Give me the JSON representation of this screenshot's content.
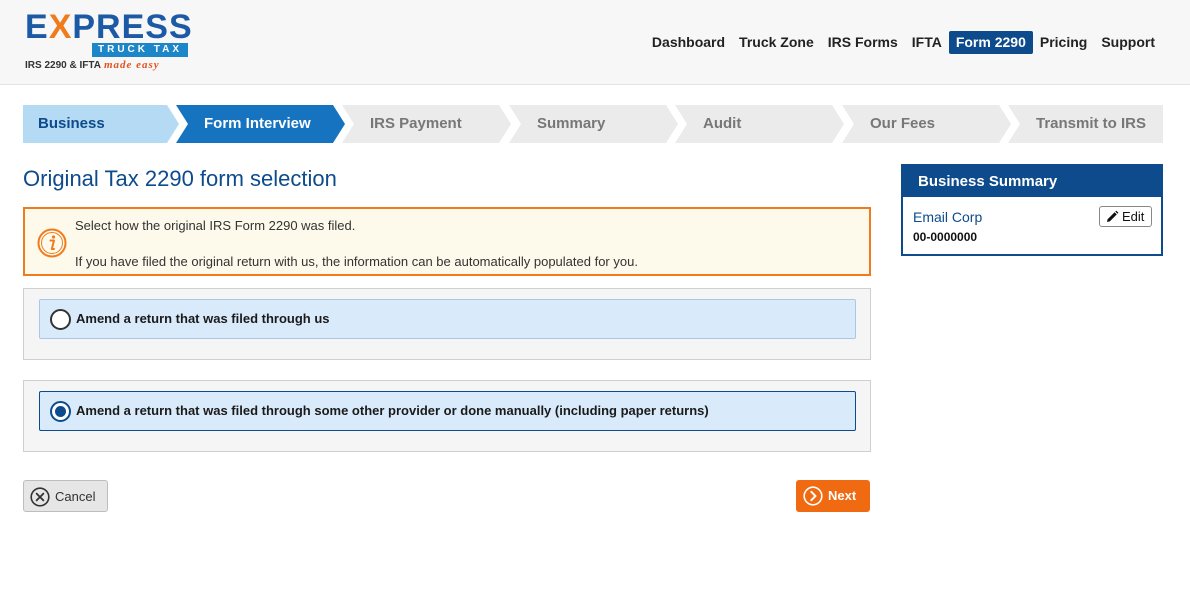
{
  "brand": {
    "word_pre": "E",
    "word_x": "X",
    "word_post": "PRESS",
    "band": "TRUCK TAX",
    "tagline": "IRS 2290 & IFTA",
    "tagline_script": "made easy",
    "colors": {
      "primary": "#1d5aa5",
      "accent": "#f07b1d",
      "band": "#1d86c9"
    }
  },
  "topnav": {
    "items": [
      {
        "label": "Dashboard",
        "active": false
      },
      {
        "label": "Truck Zone",
        "active": false
      },
      {
        "label": "IRS Forms",
        "active": false
      },
      {
        "label": "IFTA",
        "active": false
      },
      {
        "label": "Form 2290",
        "active": true
      },
      {
        "label": "Pricing",
        "active": false
      },
      {
        "label": "Support",
        "active": false
      }
    ],
    "active_color": "#0d4b8c"
  },
  "steps": {
    "items": [
      {
        "label": "Business",
        "state": "done"
      },
      {
        "label": "Form Interview",
        "state": "current"
      },
      {
        "label": "IRS Payment",
        "state": "upcoming"
      },
      {
        "label": "Summary",
        "state": "upcoming"
      },
      {
        "label": "Audit",
        "state": "upcoming"
      },
      {
        "label": "Our Fees",
        "state": "upcoming"
      },
      {
        "label": "Transmit to IRS",
        "state": "upcoming"
      }
    ],
    "colors": {
      "done": "#b5daf3",
      "current": "#1573c0",
      "upcoming": "#ebebeb"
    }
  },
  "main": {
    "title": "Original Tax 2290 form selection",
    "info": {
      "icon": "info-icon",
      "line1": "Select how the original IRS Form 2290 was filed.",
      "line2": "If you have filed the original return with us, the information can be automatically populated for you."
    },
    "options": [
      {
        "label": "Amend a return that was filed through us",
        "selected": false
      },
      {
        "label": "Amend a return that was filed through some other provider or done manually (including paper returns)",
        "selected": true
      }
    ],
    "cancel_label": "Cancel",
    "next_label": "Next"
  },
  "sidebar": {
    "title": "Business Summary",
    "business_name": "Email Corp",
    "ein": "00-0000000",
    "edit_label": "Edit"
  }
}
